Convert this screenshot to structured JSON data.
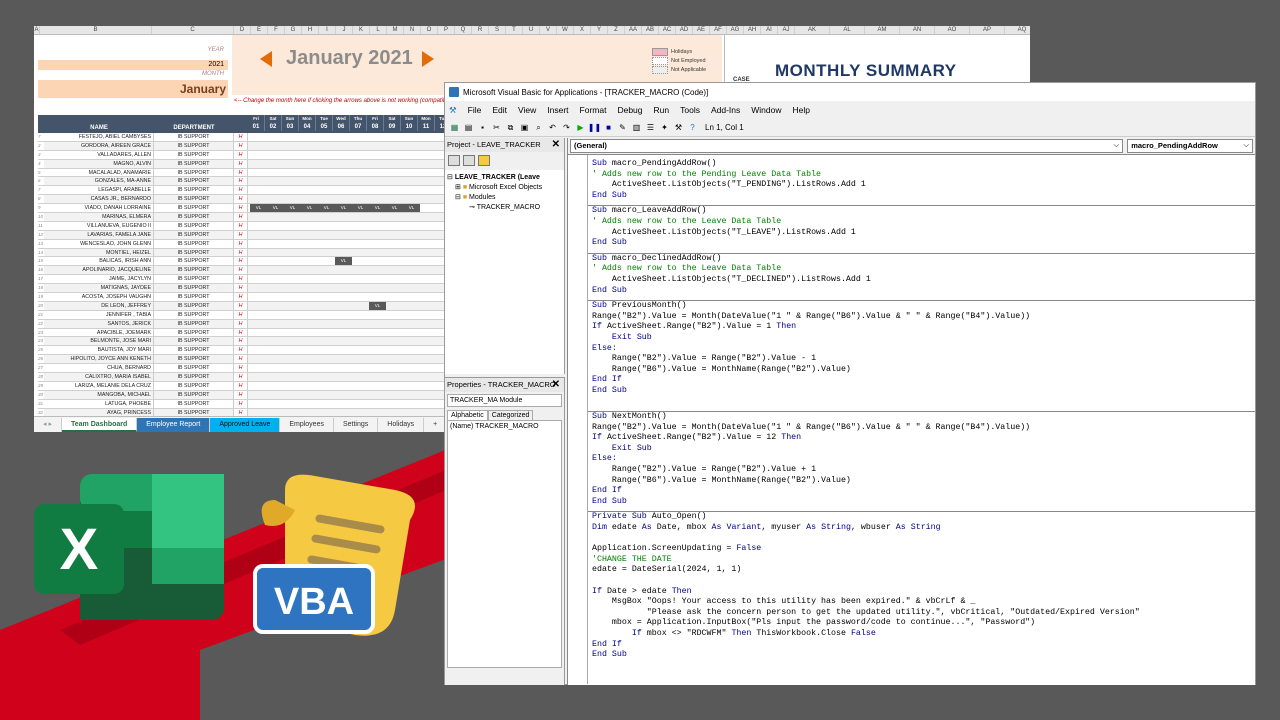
{
  "excel": {
    "column_letters": [
      "A",
      "B",
      "C",
      "D",
      "E",
      "F",
      "G",
      "H",
      "I",
      "J",
      "K",
      "L",
      "M",
      "N",
      "O",
      "P",
      "Q",
      "R",
      "S",
      "T",
      "U",
      "V",
      "W",
      "X",
      "Y",
      "Z",
      "AA",
      "AB",
      "AC",
      "AD",
      "AE",
      "AF",
      "AG",
      "AH",
      "AI",
      "AJ",
      "AK",
      "AL",
      "AM",
      "AN",
      "AO",
      "AP",
      "AQ",
      "AR"
    ],
    "year_label": "YEAR",
    "year_value": "2021",
    "month_label": "MONTH",
    "month_value": "January",
    "month_title": "January 2021",
    "legend": [
      "Holidays",
      "Not Employed",
      "Not Applicable"
    ],
    "note": "<-- Change the month here if clicking the arrows above is not working (compatibility issue). Thank you!",
    "summary_title": "MONTHLY SUMMARY",
    "summary_sub": "CASE",
    "header_name": "NAME",
    "header_department": "DEPARTMENT",
    "weekdays": [
      "Fri",
      "Sat",
      "Sun",
      "Mon",
      "Tue",
      "Wed",
      "Thu",
      "Fri",
      "Sat",
      "Sun",
      "Mon",
      "Tue",
      "Wed"
    ],
    "days": [
      "01",
      "02",
      "03",
      "04",
      "05",
      "06",
      "07",
      "08",
      "09",
      "10",
      "11",
      "12",
      "13"
    ],
    "employees": [
      {
        "no": "7",
        "name": "FESTEJO, ABIEL CAMBYSES",
        "dept": "IB SUPPORT"
      },
      {
        "no": "2",
        "name": "GORDORA, AIREEN GRACE",
        "dept": "IB SUPPORT"
      },
      {
        "no": "3",
        "name": "VALLADARES, ALLEN",
        "dept": "IB SUPPORT"
      },
      {
        "no": "4",
        "name": "MAGNO, ALVIN",
        "dept": "IB SUPPORT"
      },
      {
        "no": "5",
        "name": "MACALALAD, ANAMARIE",
        "dept": "IB SUPPORT"
      },
      {
        "no": "6",
        "name": "GONZALES, MA-ANNE",
        "dept": "IB SUPPORT"
      },
      {
        "no": "7",
        "name": "LEGASPI, ARABELLE",
        "dept": "IB SUPPORT"
      },
      {
        "no": "8",
        "name": "CASAS JR., BERNARDO",
        "dept": "IB SUPPORT"
      },
      {
        "no": "9",
        "name": "VIADO, DANAH LORRAINE",
        "dept": "IB SUPPORT"
      },
      {
        "no": "10",
        "name": "MARINAS, ELMERA",
        "dept": "IB SUPPORT"
      },
      {
        "no": "11",
        "name": "VILLANUEVA, EUGENIO II",
        "dept": "IB SUPPORT"
      },
      {
        "no": "12",
        "name": "LAVARIAS, FAMELA JANE",
        "dept": "IB SUPPORT"
      },
      {
        "no": "13",
        "name": "WENCESLAO, JOHN GLENN",
        "dept": "IB SUPPORT"
      },
      {
        "no": "14",
        "name": "MONTIEL, HEIZEL",
        "dept": "IB SUPPORT"
      },
      {
        "no": "15",
        "name": "BALICAS, IRISH ANN",
        "dept": "IB SUPPORT"
      },
      {
        "no": "16",
        "name": "APOLINARIO, JACQUELINE",
        "dept": "IB SUPPORT"
      },
      {
        "no": "17",
        "name": "JAIME, JACYLYN",
        "dept": "IB SUPPORT"
      },
      {
        "no": "18",
        "name": "MATIGNAS, JAYDEE",
        "dept": "IB SUPPORT"
      },
      {
        "no": "19",
        "name": "ACOSTA, JOSEPH VAUGHN",
        "dept": "IB SUPPORT"
      },
      {
        "no": "20",
        "name": "DE LEON, JEFFREY",
        "dept": "IB SUPPORT"
      },
      {
        "no": "21",
        "name": "JENNIFER , TABIA",
        "dept": "IB SUPPORT"
      },
      {
        "no": "22",
        "name": "SANTOS, JERICK",
        "dept": "IB SUPPORT"
      },
      {
        "no": "23",
        "name": "APACIBLE, JOEMARK",
        "dept": "IB SUPPORT"
      },
      {
        "no": "24",
        "name": "BELMONTE, JOSE MARI",
        "dept": "IB SUPPORT"
      },
      {
        "no": "25",
        "name": "BAUTISTA, JOY MARI",
        "dept": "IB SUPPORT"
      },
      {
        "no": "26",
        "name": "HIPOLITO, JOYCE ANN KENETH",
        "dept": "IB SUPPORT"
      },
      {
        "no": "27",
        "name": "CHUA, BERNARD",
        "dept": "IB SUPPORT"
      },
      {
        "no": "28",
        "name": "CALIXTRO, MARIA ISABEL",
        "dept": "IB SUPPORT"
      },
      {
        "no": "29",
        "name": "LARIZA, MELANIE DELA CRUZ",
        "dept": "IB SUPPORT"
      },
      {
        "no": "30",
        "name": "MANGOBA, MICHAEL",
        "dept": "IB SUPPORT"
      },
      {
        "no": "31",
        "name": "LATUGA, PHOEBE",
        "dept": "IB SUPPORT"
      },
      {
        "no": "32",
        "name": "AYAG, PRINCESS",
        "dept": "IB SUPPORT"
      }
    ],
    "holiday_mark": "H",
    "leave_mark": "VL",
    "sheet_tabs": [
      "Team Dashboard",
      "Employee Report",
      "Approved Leave",
      "Employees",
      "Settings",
      "Holidays",
      "+"
    ]
  },
  "vbe": {
    "title": "Microsoft Visual Basic for Applications - [TRACKER_MACRO (Code)]",
    "menu": [
      "File",
      "Edit",
      "View",
      "Insert",
      "Format",
      "Debug",
      "Run",
      "Tools",
      "Add-Ins",
      "Window",
      "Help"
    ],
    "status": "Ln 1, Col 1",
    "project_title": "Project - LEAVE_TRACKER",
    "project_root": "LEAVE_TRACKER (Leave",
    "tree_objects": "Microsoft Excel Objects",
    "tree_modules": "Modules",
    "tree_module": "TRACKER_MACRO",
    "properties_title": "Properties - TRACKER_MACRO",
    "prop_select": "TRACKER_MA Module",
    "prop_tabs": [
      "Alphabetic",
      "Categorized"
    ],
    "prop_row": "(Name) TRACKER_MACRO",
    "combo_left": "(General)",
    "combo_right": "macro_PendingAddRow",
    "code_lines": [
      "Sub macro_PendingAddRow()",
      "' Adds new row to the Pending Leave Data Table",
      "    ActiveSheet.ListObjects(\"T_PENDING\").ListRows.Add 1",
      "End Sub",
      "---",
      "Sub macro_LeaveAddRow()",
      "' Adds new row to the Leave Data Table",
      "    ActiveSheet.ListObjects(\"T_LEAVE\").ListRows.Add 1",
      "End Sub",
      "---",
      "Sub macro_DeclinedAddRow()",
      "' Adds new row to the Leave Data Table",
      "    ActiveSheet.ListObjects(\"T_DECLINED\").ListRows.Add 1",
      "End Sub",
      "---",
      "Sub PreviousMonth()",
      "Range(\"B2\").Value = Month(DateValue(\"1 \" & Range(\"B6\").Value & \" \" & Range(\"B4\").Value))",
      "If ActiveSheet.Range(\"B2\").Value = 1 Then",
      "    Exit Sub",
      "Else:",
      "    Range(\"B2\").Value = Range(\"B2\").Value - 1",
      "    Range(\"B6\").Value = MonthName(Range(\"B2\").Value)",
      "End If",
      "End Sub",
      "",
      "---",
      "Sub NextMonth()",
      "Range(\"B2\").Value = Month(DateValue(\"1 \" & Range(\"B6\").Value & \" \" & Range(\"B4\").Value))",
      "If ActiveSheet.Range(\"B2\").Value = 12 Then",
      "    Exit Sub",
      "Else:",
      "    Range(\"B2\").Value = Range(\"B2\").Value + 1",
      "    Range(\"B6\").Value = MonthName(Range(\"B2\").Value)",
      "End If",
      "End Sub",
      "---",
      "Private Sub Auto_Open()",
      "Dim edate As Date, mbox As Variant, myuser As String, wbuser As String",
      "",
      "Application.ScreenUpdating = False",
      "'CHANGE THE DATE",
      "edate = DateSerial(2024, 1, 1)",
      "",
      "If Date > edate Then",
      "    MsgBox \"Oops! Your access to this utility has been expired.\" & vbCrLf & _",
      "           \"Please ask the concern person to get the updated utility.\", vbCritical, \"Outdated/Expired Version\"",
      "    mbox = Application.InputBox(\"Pls input the password/code to continue...\", \"Password\")",
      "        If mbox <> \"RDCWFM\" Then ThisWorkbook.Close False",
      "End If",
      "End Sub"
    ]
  },
  "logos": {
    "excel_letter": "X",
    "vba_label": "VBA"
  },
  "colors": {
    "excel_green": "#217346",
    "vba_blue": "#2f74c0",
    "scroll_yellow": "#f6c942",
    "band_red": "#d0021b"
  }
}
